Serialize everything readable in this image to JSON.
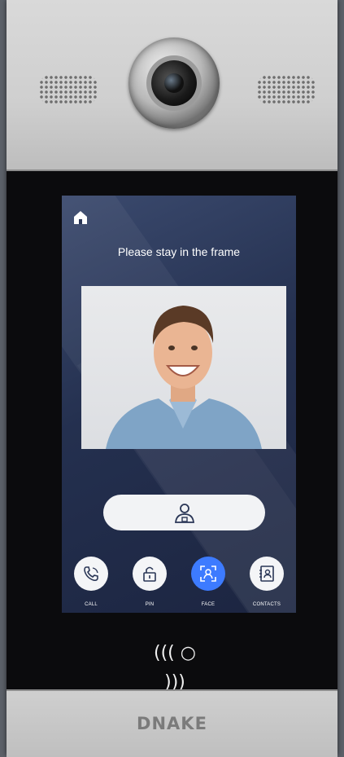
{
  "screen": {
    "message": "Please stay in the frame"
  },
  "nav": {
    "items": [
      {
        "label": "CALL",
        "icon": "phone-icon",
        "active": false
      },
      {
        "label": "PIN",
        "icon": "lock-icon",
        "active": false
      },
      {
        "label": "FACE",
        "icon": "face-scan-icon",
        "active": true
      },
      {
        "label": "CONTACTS",
        "icon": "contacts-icon",
        "active": false
      }
    ]
  },
  "reader": {
    "symbol": "((( ○ )))"
  },
  "brand": {
    "name": "DNAKE"
  },
  "colors": {
    "accent": "#3d7bff",
    "screen_bg": "#24304f",
    "panel": "#cfcfcf"
  }
}
